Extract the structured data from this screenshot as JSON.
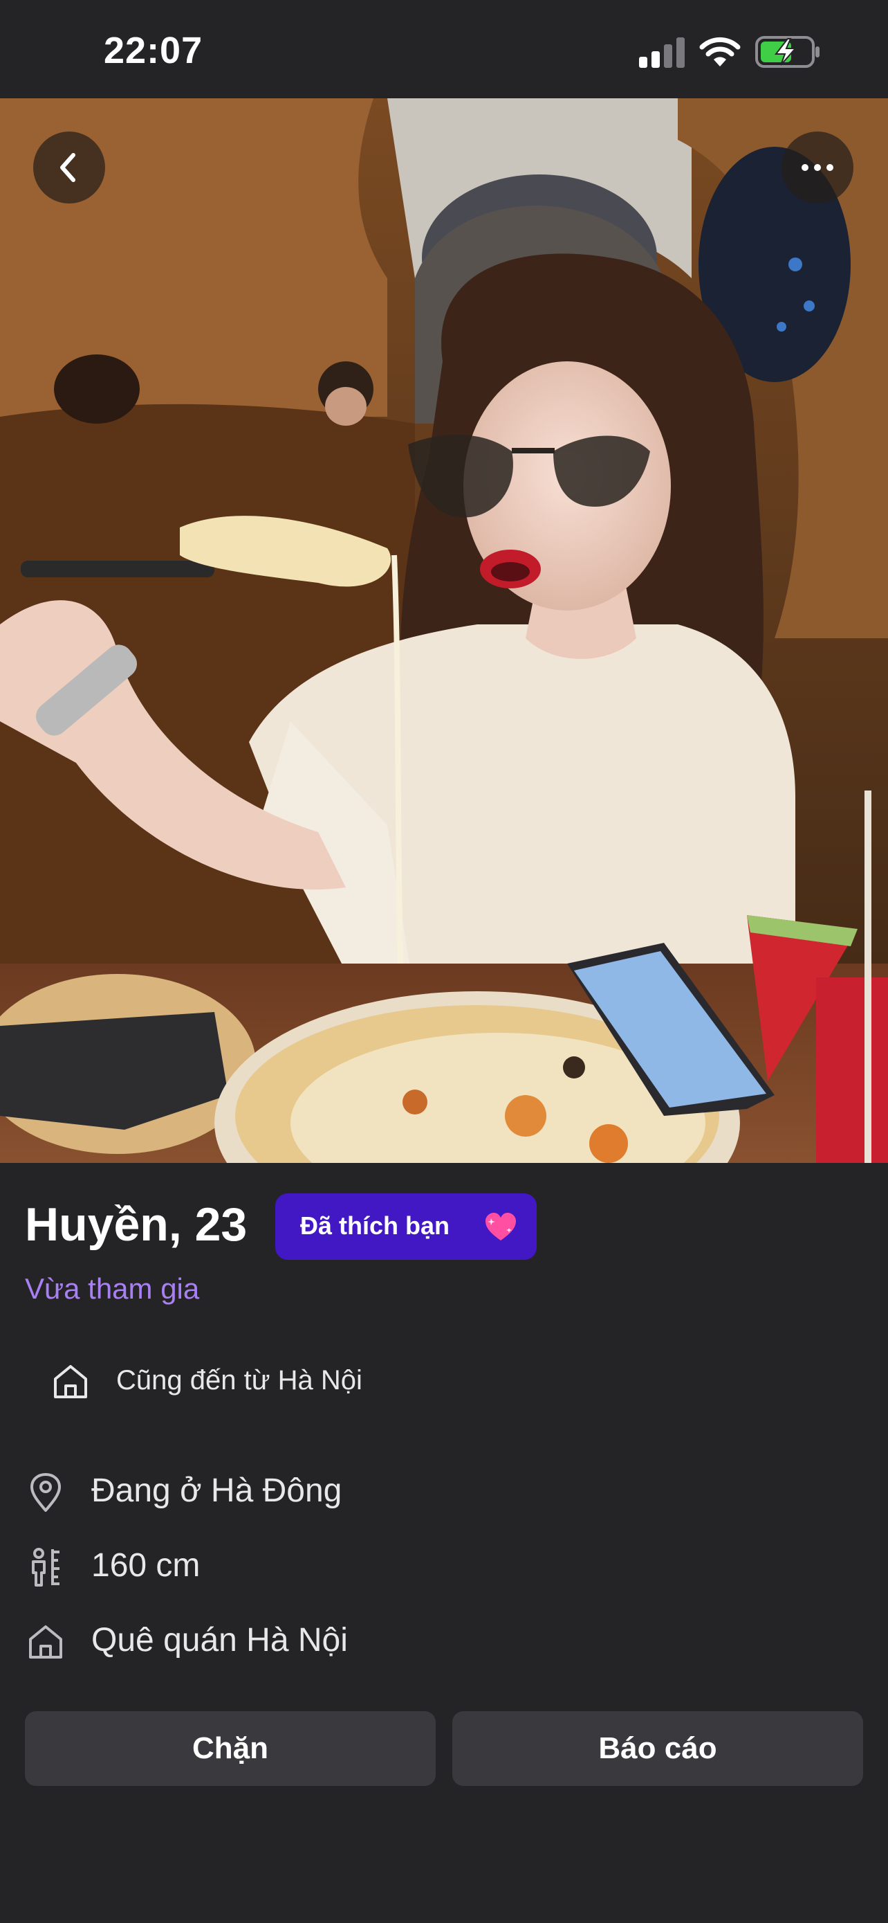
{
  "status_bar": {
    "time": "22:07",
    "icons": [
      "signal-icon",
      "wifi-icon",
      "battery-charging-icon"
    ]
  },
  "photo": {
    "description_icons": [
      "back-icon",
      "more-icon"
    ]
  },
  "profile": {
    "name_age": "Huyền, 23",
    "liked_badge": "Đã thích bạn",
    "liked_badge_icon": "sparkling-heart-icon",
    "joined_status": "Vừa tham gia",
    "hometown_match": "Cũng đến từ Hà Nội",
    "details": {
      "living": "Đang ở Hà Đông",
      "height": "160 cm",
      "origin": "Quê quán Hà Nội"
    }
  },
  "actions": {
    "block": "Chặn",
    "report": "Báo cáo"
  },
  "colors": {
    "background": "#242427",
    "badge": "#4217c4",
    "joined": "#a880f2",
    "button": "#3a3a3e",
    "battery_green": "#3fce45"
  }
}
